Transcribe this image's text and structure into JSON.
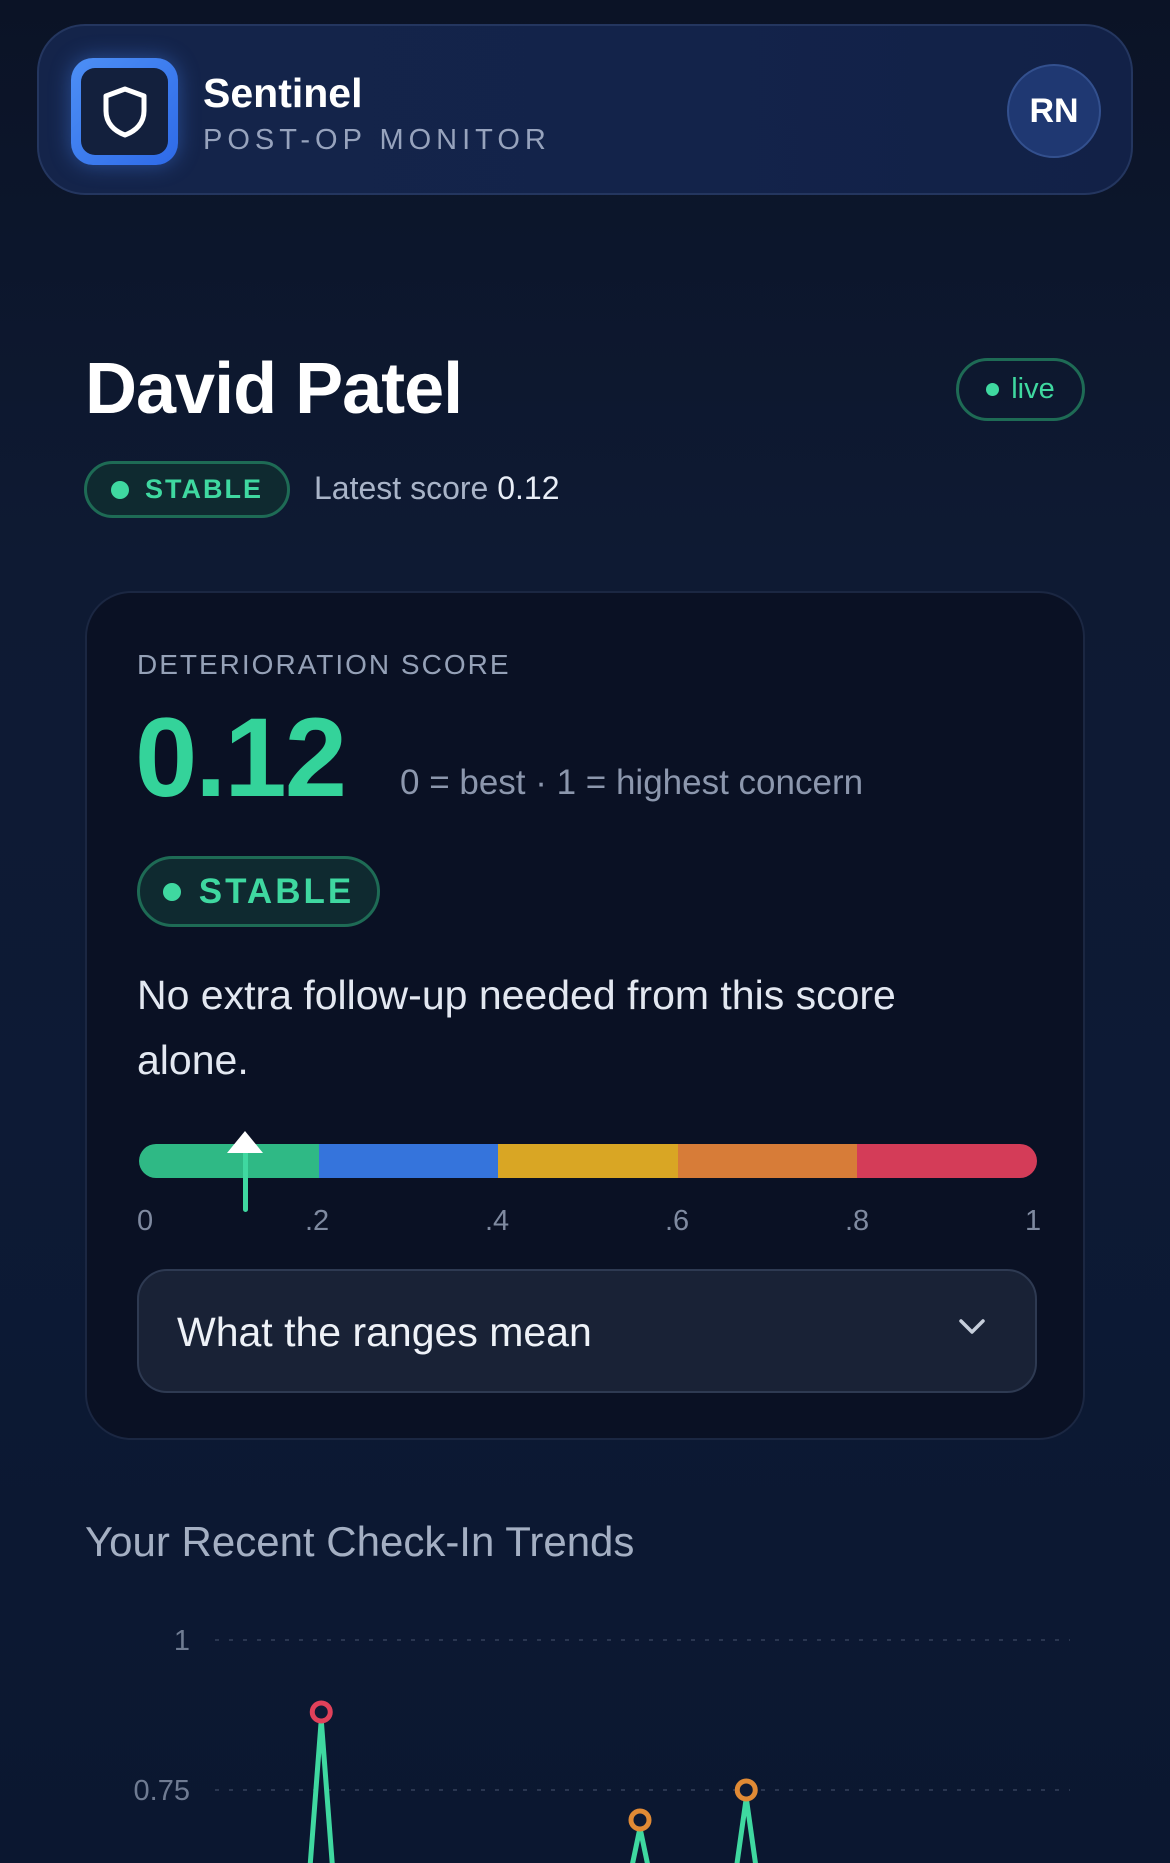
{
  "header": {
    "brand_name": "Sentinel",
    "brand_subtitle": "POST-OP MONITOR",
    "logo_icon": "shield-icon",
    "avatar_initials": "RN"
  },
  "patient": {
    "name": "David Patel",
    "live_label": "live",
    "status_label": "STABLE",
    "latest_prefix": "Latest score",
    "latest_value": "0.12"
  },
  "score_card": {
    "label": "DETERIORATION SCORE",
    "score": "0.12",
    "score_value": 0.12,
    "scale_note": "0 = best · 1 = highest concern",
    "status_label": "STABLE",
    "message": "No extra follow-up needed from this score alone.",
    "range_colors": [
      "#2fb985",
      "#3574dc",
      "#d9a624",
      "#d77c38",
      "#d43c58"
    ],
    "ticks": [
      "0",
      ".2",
      ".4",
      ".6",
      ".8",
      "1"
    ],
    "accordion_label": "What the ranges mean",
    "accordion_icon": "chevron-down-icon"
  },
  "trends": {
    "title": "Your Recent Check-In Trends"
  },
  "chart_data": {
    "type": "line",
    "y_tick_labels": [
      "1",
      "0.75"
    ],
    "ylim": [
      0,
      1
    ],
    "x": [
      0,
      1,
      2,
      3,
      4,
      5,
      6,
      7,
      8
    ],
    "points": [
      {
        "x": 1,
        "y": 0.88,
        "color": "#e0415a"
      },
      {
        "x": 4,
        "y": 0.7,
        "color": "#e08a35"
      },
      {
        "x": 5,
        "y": 0.75,
        "color": "#e08a35"
      }
    ],
    "line_color": "#3fd8a0",
    "grid": true
  }
}
